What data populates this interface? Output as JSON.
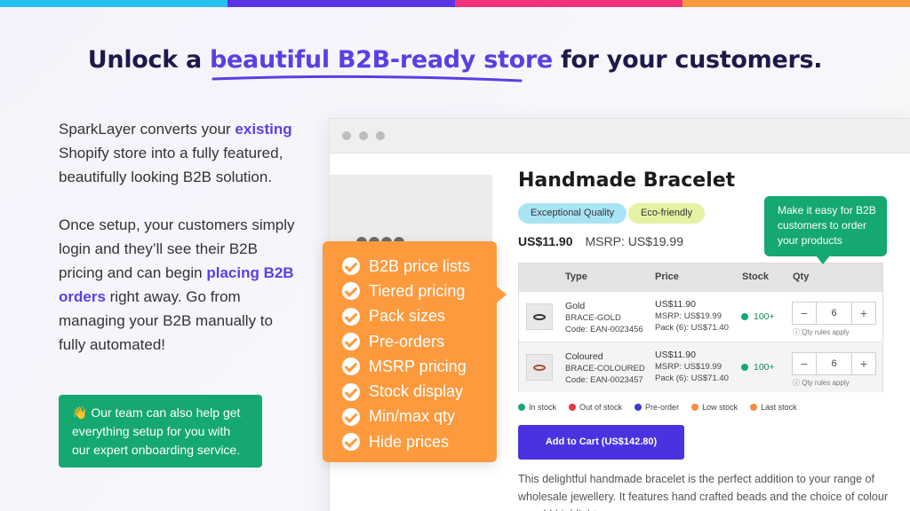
{
  "colors": {
    "accent": "#5b3fe4",
    "green": "#15a871",
    "orange": "#fd9a3e",
    "button": "#4b32e0"
  },
  "topbar": [
    "#27c1f0",
    "#5b34e6",
    "#f2327a",
    "#fd9a3e"
  ],
  "headline": {
    "before": "Unlock a ",
    "highlight": "beautiful B2B-ready store",
    "after": " for your customers."
  },
  "intro": {
    "p1_a": "SparkLayer converts your ",
    "p1_em": "existing",
    "p1_b": " Shopify store into a fully featured, beautifully looking B2B solution.",
    "p2_a": "Once setup, your customers simply login and they’ll see their B2B pricing and can begin ",
    "p2_em": "placing B2B orders",
    "p2_b": " right away. Go from managing your B2B manually to fully automated!"
  },
  "team_note": "👋 Our team can also help get everything setup for you with our expert onboarding service.",
  "product": {
    "title": "Handmade Bracelet",
    "badges": [
      "Exceptional Quality",
      "Eco-friendly"
    ],
    "price": "US$11.90",
    "msrp": "MSRP: US$19.99",
    "table": {
      "headers": [
        "Type",
        "Price",
        "Stock",
        "Qty"
      ],
      "rows": [
        {
          "name": "Gold",
          "sku": "BRACE-GOLD",
          "code": "Code: EAN-0023456",
          "price": "US$11.90",
          "msrp": "MSRP: US$19.99",
          "pack": "Pack (6): US$71.40",
          "stock": "100+",
          "qty": "6",
          "rule": "Qty rules apply"
        },
        {
          "name": "Coloured",
          "sku": "BRACE-COLOURED",
          "code": "Code: EAN-0023457",
          "price": "US$11.90",
          "msrp": "MSRP: US$19.99",
          "pack": "Pack (6): US$71.40",
          "stock": "100+",
          "qty": "6",
          "rule": "Qty rules apply"
        }
      ]
    },
    "legend": [
      {
        "label": "In stock",
        "color": "#15a871"
      },
      {
        "label": "Out of stock",
        "color": "#e0393e"
      },
      {
        "label": "Pre-order",
        "color": "#3b3bd6"
      },
      {
        "label": "Low stock",
        "color": "#fd8a3e"
      },
      {
        "label": "Last stock",
        "color": "#fd8a3e"
      }
    ],
    "cart_button": "Add to Cart (US$142.80)",
    "description": "This delightful handmade bracelet is the perfect addition to your range of wholesale jewellery. It features hand crafted beads and the choice of colour or gold highlights."
  },
  "features": [
    "B2B price lists",
    "Tiered pricing",
    "Pack sizes",
    "Pre-orders",
    "MSRP pricing",
    "Stock display",
    "Min/max qty",
    "Hide prices"
  ],
  "tip": "Make it easy for B2B customers to order your products"
}
